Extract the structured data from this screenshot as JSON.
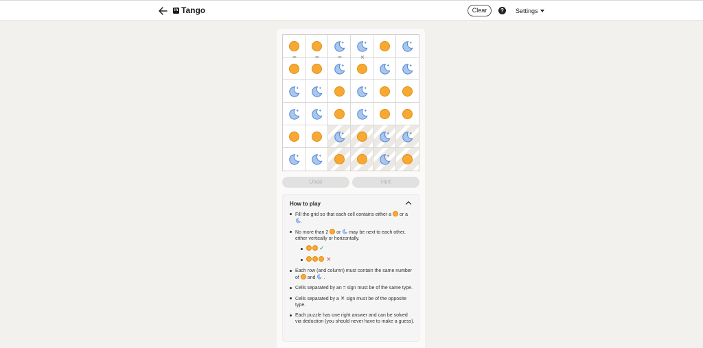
{
  "header": {
    "title": "Tango",
    "logo_text": "in",
    "clear_label": "Clear",
    "help_label": "?",
    "settings_label": "Settings"
  },
  "board": {
    "rows": [
      [
        "sun",
        "sun",
        "moon",
        "moon",
        "sun",
        "moon"
      ],
      [
        "sun",
        "sun",
        "moon",
        "sun",
        "moon",
        "moon"
      ],
      [
        "moon",
        "moon",
        "sun",
        "moon",
        "sun",
        "sun"
      ],
      [
        "moon",
        "moon",
        "sun",
        "moon",
        "sun",
        "sun"
      ],
      [
        "sun",
        "sun",
        "moon",
        "sun",
        "moon",
        "moon"
      ],
      [
        "moon",
        "moon",
        "sun",
        "sun",
        "moon",
        "sun"
      ]
    ],
    "error_cells": [
      [
        4,
        2
      ],
      [
        4,
        3
      ],
      [
        4,
        4
      ],
      [
        4,
        5
      ],
      [
        5,
        2
      ],
      [
        5,
        3
      ],
      [
        5,
        4
      ],
      [
        5,
        5
      ]
    ],
    "signs": [
      {
        "between": [
          [
            0,
            0
          ],
          [
            1,
            0
          ]
        ],
        "symbol": "="
      },
      {
        "between": [
          [
            0,
            1
          ],
          [
            1,
            1
          ]
        ],
        "symbol": "="
      },
      {
        "between": [
          [
            0,
            2
          ],
          [
            1,
            2
          ]
        ],
        "symbol": "="
      },
      {
        "between": [
          [
            0,
            3
          ],
          [
            1,
            3
          ]
        ],
        "symbol": "×"
      }
    ],
    "colors": {
      "sun_fill": "#f7a934",
      "sun_border": "#e38d10",
      "moon_fill": "#a9c6ee",
      "moon_border": "#5b8ed6",
      "error_stripe": "#ece8e4"
    }
  },
  "controls": {
    "undo_label": "Undo",
    "hint_label": "Hint"
  },
  "howto": {
    "heading": "How to play",
    "r1_a": "Fill the grid so that each cell contains either a",
    "r1_b": "or",
    "r1_c": "a",
    "r1_d": ".",
    "r2_a": "No more than 2",
    "r2_b": "or",
    "r2_c": "may be next to each other, either vertically or horizontally.",
    "r2_ok": "✓",
    "r2_bad": "×",
    "r3_a": "Each row (and column) must contain the same number of",
    "r3_b": "and",
    "r3_c": ".",
    "r4": "Cells separated by an = sign must be of the same type.",
    "r5_a": "Cells separated by a",
    "r5_x": "✕",
    "r5_b": "sign must be of the opposite type.",
    "r6": "Each puzzle has one right answer and can be solved via deduction (you should never have to make a guess)."
  }
}
